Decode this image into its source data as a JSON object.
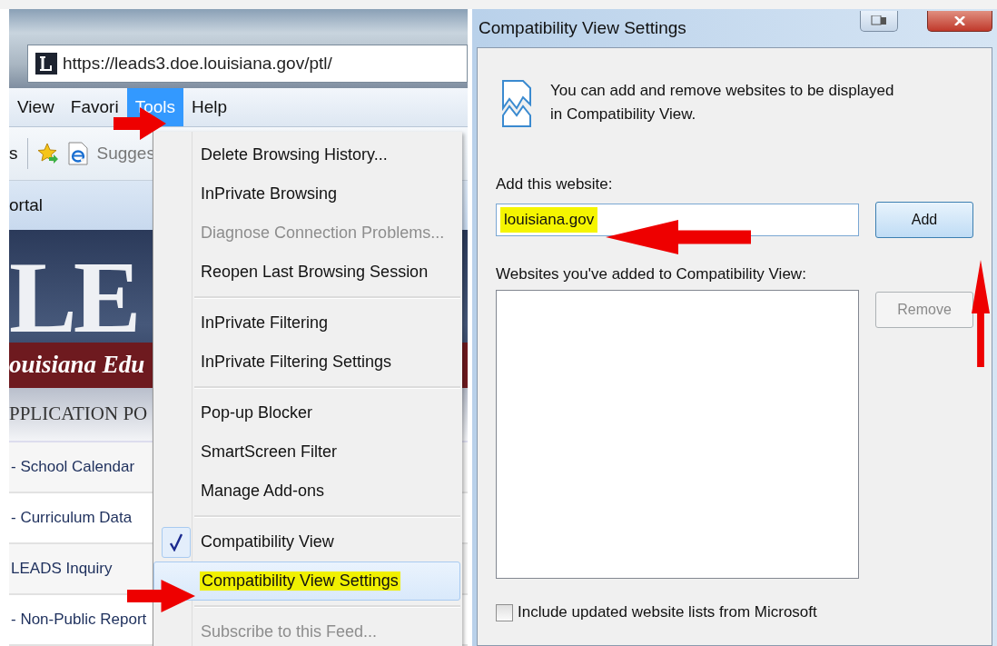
{
  "browser": {
    "address": "https://leads3.doe.louisiana.gov/ptl/",
    "menu_bar": [
      {
        "label": "View",
        "selected": false
      },
      {
        "label": "Favori",
        "selected": false
      },
      {
        "label": "Tools",
        "selected": true
      },
      {
        "label": "Help",
        "selected": false
      }
    ],
    "toolbar": {
      "cut_label": "s",
      "link": "Sugges"
    },
    "tab": "ortal",
    "banner": {
      "logo_text": "LE",
      "tagline": "ouisiana Edu"
    },
    "section_heading": "PPLICATION PO",
    "links": [
      "- School Calendar",
      "- Curriculum Data",
      "LEADS Inquiry",
      "- Non-Public Report"
    ]
  },
  "tools_menu": {
    "groups": [
      [
        {
          "label": "Delete Browsing History...",
          "disabled": false,
          "checked": false,
          "selected": false
        },
        {
          "label": "InPrivate Browsing",
          "disabled": false,
          "checked": false,
          "selected": false
        },
        {
          "label": "Diagnose Connection Problems...",
          "disabled": true,
          "checked": false,
          "selected": false
        },
        {
          "label": "Reopen Last Browsing Session",
          "disabled": false,
          "checked": false,
          "selected": false
        }
      ],
      [
        {
          "label": "InPrivate Filtering",
          "disabled": false,
          "checked": false,
          "selected": false
        },
        {
          "label": "InPrivate Filtering Settings",
          "disabled": false,
          "checked": false,
          "selected": false
        }
      ],
      [
        {
          "label": "Pop-up Blocker",
          "disabled": false,
          "checked": false,
          "selected": false
        },
        {
          "label": "SmartScreen Filter",
          "disabled": false,
          "checked": false,
          "selected": false
        },
        {
          "label": "Manage Add-ons",
          "disabled": false,
          "checked": false,
          "selected": false
        }
      ],
      [
        {
          "label": "Compatibility View",
          "disabled": false,
          "checked": true,
          "selected": false
        },
        {
          "label": "Compatibility View Settings",
          "disabled": false,
          "checked": false,
          "selected": true
        }
      ],
      [
        {
          "label": "Subscribe to this Feed...",
          "disabled": true,
          "checked": false,
          "selected": false
        }
      ]
    ]
  },
  "dialog": {
    "title": "Compatibility View Settings",
    "info": "You can add and remove websites to be displayed in Compatibility View.",
    "site_label": "Add this website:",
    "site_value": "louisiana.gov",
    "add_button": {
      "label": "Add",
      "disabled": false
    },
    "list_label": "Websites you've added to Compatibility View:",
    "remove_button": {
      "label": "Remove",
      "disabled": true
    },
    "include_option": {
      "label": "Include updated website lists from Microsoft",
      "checked": false
    }
  }
}
